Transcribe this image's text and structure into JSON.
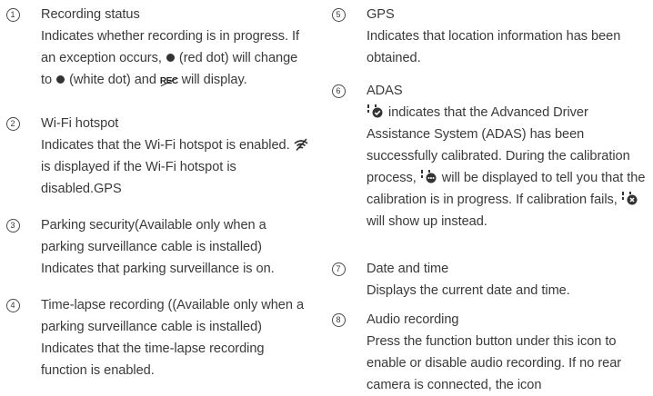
{
  "left_items": [
    {
      "num": "1",
      "title": "Recording status",
      "body_a": "Indicates whether recording is in progress. If an exception occurs,",
      "body_b": "(red dot) will change to",
      "body_c": "(white dot) and",
      "rec_label": "REC",
      "body_d": "will display."
    },
    {
      "num": "2",
      "title": "Wi-Fi hotspot",
      "body_a": "Indicates that the Wi-Fi hotspot is enabled.",
      "body_b": "is displayed if the Wi-Fi hotspot is disabled.GPS"
    },
    {
      "num": "3",
      "title": "Parking security(Available only when a parking surveillance cable is installed)",
      "body": "Indicates that parking surveillance is on."
    },
    {
      "num": "4",
      "title": "Time-lapse recording ((Available only when a parking surveillance cable is installed)",
      "body": "Indicates that the time-lapse recording function is enabled."
    }
  ],
  "right_items": [
    {
      "num": "5",
      "title": "GPS",
      "body": "Indicates that location information has been obtained."
    },
    {
      "num": "6",
      "title": "ADAS",
      "body_a": "indicates that the Advanced Driver Assistance System (ADAS) has been successfully calibrated. During the calibration process,",
      "body_b": "will be displayed to tell you that the calibration is in progress. If calibration fails,",
      "body_c": "will show up instead."
    },
    {
      "num": "7",
      "title": "Date and time",
      "body": "Displays the current date and time."
    },
    {
      "num": "8",
      "title": "Audio recording",
      "body": "Press the function button under this icon to enable or disable audio recording. If no rear camera is connected, the icon"
    }
  ],
  "icons": {
    "red_dot": "dot-icon",
    "white_dot": "dot-icon",
    "rec": "rec-crossed-icon",
    "wifi_off": "wifi-off-icon",
    "adas_check": "adas-check-icon",
    "adas_progress": "adas-progress-icon",
    "adas_fail": "adas-fail-icon"
  }
}
